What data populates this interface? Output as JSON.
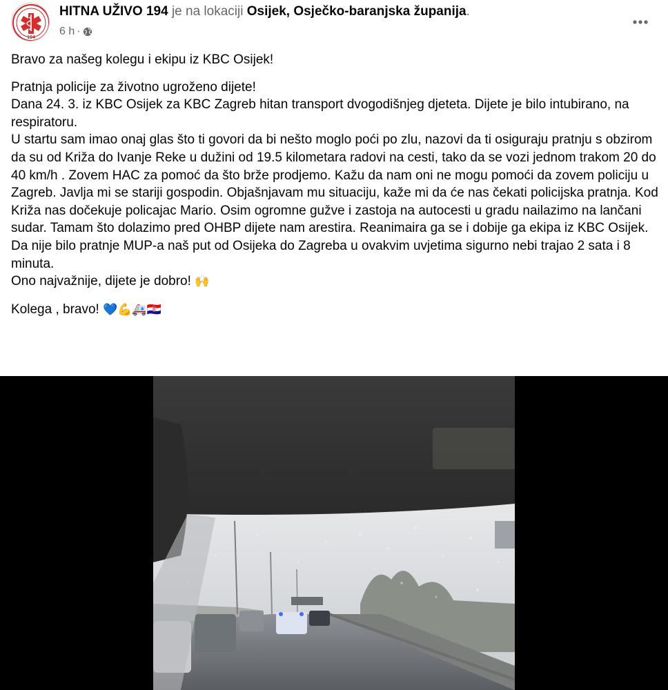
{
  "post": {
    "author": "HITNA UŽIVO 194",
    "location_prefix": "je na lokaciji",
    "location": "Osijek, Osječko-baranjska županija",
    "location_suffix": ".",
    "time": "6 h",
    "separator": "·",
    "avatar_text": "194",
    "paragraphs": [
      "Bravo za našeg kolegu i ekipu iz KBC Osijek!",
      "Pratnja policije za životno ugroženo dijete!",
      "Dana 24. 3.  iz KBC Osijek za KBC Zagreb hitan transport dvogodišnjeg djeteta.  Dijete je bilo intubirano, na respiratoru.",
      "U startu sam imao onaj glas što ti govori da bi nešto moglo poći po zlu,  nazovi da ti osiguraju pratnju s obzirom da su  od  Križa do Ivanje Reke u dužini od 19.5 kilometara radovi na cesti, tako da se vozi jednom trakom 20 do 40 km/h . Zovem  HAC  za pomoć da što brže prodjemo. Kažu da nam oni ne  mogu pomoći da zovem policiju u Zagreb. Javlja mi se stariji gospodin. Objašnjavam mu situaciju, kaže mi da će nas čekati policijska pratnja. Kod Križa nas dočekuje policajac Mario. Osim ogromne gužve i zastoja na autocesti u gradu nailazimo na lančani sudar. Tamam što dolazimo pred  OHBP  dijete nam arestira. Reanimaira ga se i dobije ga ekipa iz KBC Osijek. Da nije bilo pratnje MUP-a  naš put od Osijeka do Zagreba u ovakvim uvjetima sigurno nebi trajao 2 sata i 8 minuta.",
      "Ono najvažnije, dijete je dobro!",
      "Kolega , bravo!"
    ],
    "emojis": {
      "raised_hands": "🙌",
      "closing": "💙💪🚑🇭🇷"
    }
  },
  "colors": {
    "text_primary": "#050505",
    "text_secondary": "#65676b",
    "media_background": "#000000"
  },
  "icons": [
    "globe-icon",
    "more-options-icon",
    "avatar-medical-logo"
  ]
}
